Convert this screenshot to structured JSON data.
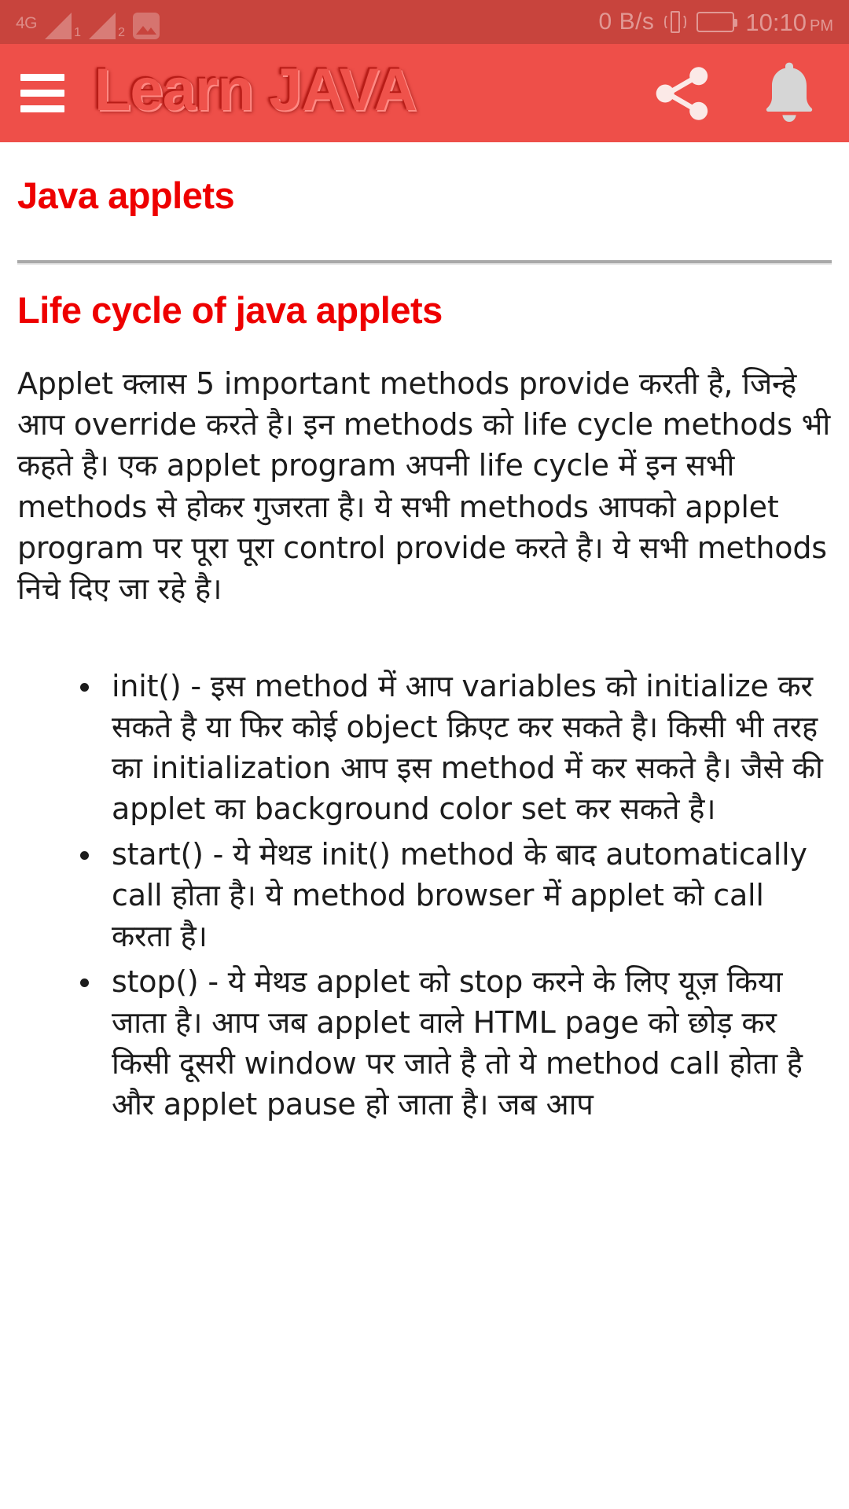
{
  "status_bar": {
    "network_type": "4G",
    "sim1_label": "1",
    "sim2_label": "2",
    "gallery_icon": "gallery-icon",
    "net_speed": "0 B/s",
    "vibrate_icon": "vibrate-icon",
    "battery_icon": "battery-icon",
    "time": "10:10",
    "am_pm": "PM",
    "background_color": "#c8443d"
  },
  "app_bar": {
    "menu_icon": "hamburger-menu-icon",
    "title": "Learn JAVA",
    "share_icon": "share-icon",
    "notification_icon": "bell-icon",
    "background_color": "#ee4f49",
    "title_color": "#ef524b"
  },
  "content": {
    "heading_color": "#ee0000",
    "page_title": "Java applets",
    "section_title": "Life cycle of java applets",
    "intro_paragraph": "Applet क्लास 5 important methods provide करती है, जिन्हे आप override करते है। इन methods को life cycle methods भी कहते है। एक applet program अपनी life cycle में इन सभी methods से होकर गुजरता है। ये सभी methods आपको applet program पर पूरा पूरा control provide करते है। ये सभी methods निचे दिए जा रहे है।",
    "methods": [
      "init() - इस method में आप variables को initialize कर सकते है या फिर कोई object क्रिएट कर सकते है। किसी भी तरह का initialization आप इस method में कर सकते है। जैसे की applet का background color set कर सकते है।",
      "start() - ये मेथड init() method के बाद automatically call होता है। ये method browser में applet को call करता है।",
      "stop() - ये मेथड applet को stop करने के लिए यूज़ किया जाता है। आप जब applet वाले HTML page को छोड़ कर किसी दूसरी window पर जाते है तो ये method call होता है और applet pause हो जाता है। जब आप"
    ]
  }
}
